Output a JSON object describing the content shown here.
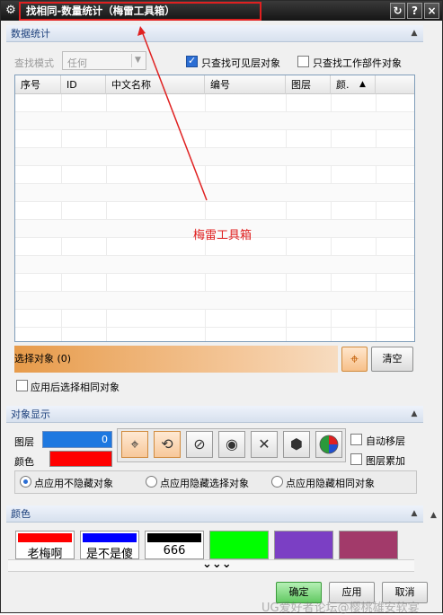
{
  "window": {
    "title": "找相同-数量统计（梅雷工具箱）",
    "annotation_text": "梅雷工具箱",
    "watermark": "UG爱好者论坛@樱桃雄安软宴"
  },
  "stats_section": {
    "header": "数据统计",
    "search_mode_label": "查找模式",
    "search_mode_value": "任何",
    "visible_only_label": "只查找可见层对象",
    "visible_only_checked": true,
    "work_part_label": "只查找工作部件对象",
    "work_part_checked": false,
    "columns": [
      "序号",
      "ID",
      "中文名称",
      "编号",
      "图层",
      "颜."
    ],
    "select_object_label": "选择对象 (0)",
    "clear_label": "清空",
    "apply_select_same_label": "应用后选择相同对象"
  },
  "display_section": {
    "header": "对象显示",
    "layer_label": "图层",
    "layer_value": "0",
    "color_label": "颜色",
    "color_value": "#ff0000",
    "auto_move_layer_label": "自动移层",
    "layer_accumulate_label": "图层累加",
    "radio_options": [
      "点应用不隐藏对象",
      "点应用隐藏选择对象",
      "点应用隐藏相同对象"
    ],
    "radio_selected": 0
  },
  "color_section": {
    "header": "颜色",
    "swatches": [
      {
        "color": "#ff0000",
        "text": "老梅啊"
      },
      {
        "color": "#0000ff",
        "text": "是不是傻"
      },
      {
        "color": "#000000",
        "text": "666"
      },
      {
        "color": "#00ff00",
        "text": ""
      },
      {
        "color": "#7b3fc4",
        "text": ""
      },
      {
        "color": "#a23a6a",
        "text": ""
      }
    ],
    "more_label": "⌄⌄⌄"
  },
  "footer": {
    "ok_label": "确定",
    "apply_label": "应用",
    "cancel_label": "取消"
  },
  "colors": {
    "annotation": "#e02020",
    "ok_button_bg": "#7fd77f"
  }
}
